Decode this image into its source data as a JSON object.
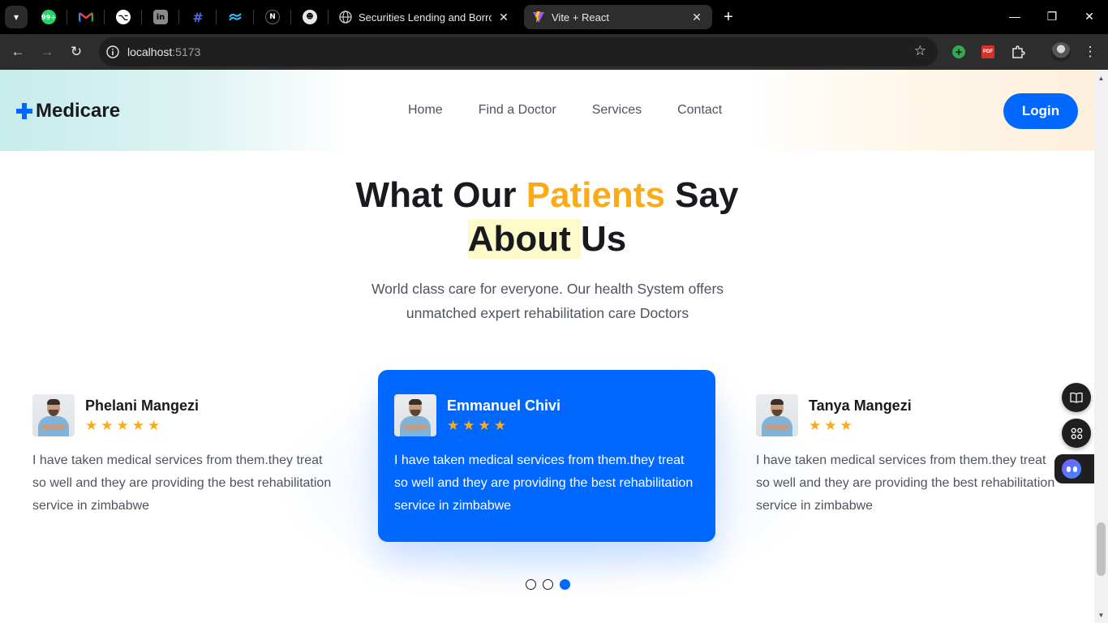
{
  "browser": {
    "tabs": [
      {
        "title": "Securities Lending and Borrowing",
        "active": false
      },
      {
        "title": "Vite + React",
        "active": true
      }
    ],
    "pinned_icons": [
      "whatsapp-icon",
      "gmail-icon",
      "github-icon",
      "linkedin-icon",
      "hashnode-icon",
      "tailwind-icon",
      "nextjs-icon",
      "chatbot-icon"
    ],
    "whatsapp_badge": "99+",
    "url_host": "localhost",
    "url_port": ":5173",
    "extensions": [
      "add-extension-icon",
      "pdf-icon",
      "extensions-puzzle-icon",
      "profile-avatar"
    ]
  },
  "header": {
    "logo": "Medicare",
    "nav": [
      "Home",
      "Find a Doctor",
      "Services",
      "Contact"
    ],
    "login_label": "Login"
  },
  "section": {
    "heading_part1": "What Our ",
    "heading_accent": "Patients",
    "heading_part2": " Say",
    "heading_highlight": "About ",
    "heading_part3": "Us",
    "subtitle": "World class care for everyone. Our health System offers unmatched expert rehabilitation care Doctors"
  },
  "testimonials": [
    {
      "name": "Phelani Mangezi",
      "rating": 5,
      "text": "I have taken medical services from them.they treat so well and they are providing the best rehabilitation service in zimbabwe"
    },
    {
      "name": "Emmanuel Chivi",
      "rating": 4,
      "text": "I have taken medical services from them.they treat so well and they are providing the best rehabilitation service in zimbabwe"
    },
    {
      "name": "Tanya Mangezi",
      "rating": 3,
      "text": "I have taken medical services from them.they treat so well and they are providing the best rehabilitation service in zimbabwe"
    }
  ],
  "pagination": {
    "total": 3,
    "active_index": 3
  },
  "colors": {
    "primary": "#0067ff",
    "accent": "#fbab18",
    "heading": "#181a1e",
    "text": "#4e545f",
    "highlight": "#fffac9"
  }
}
